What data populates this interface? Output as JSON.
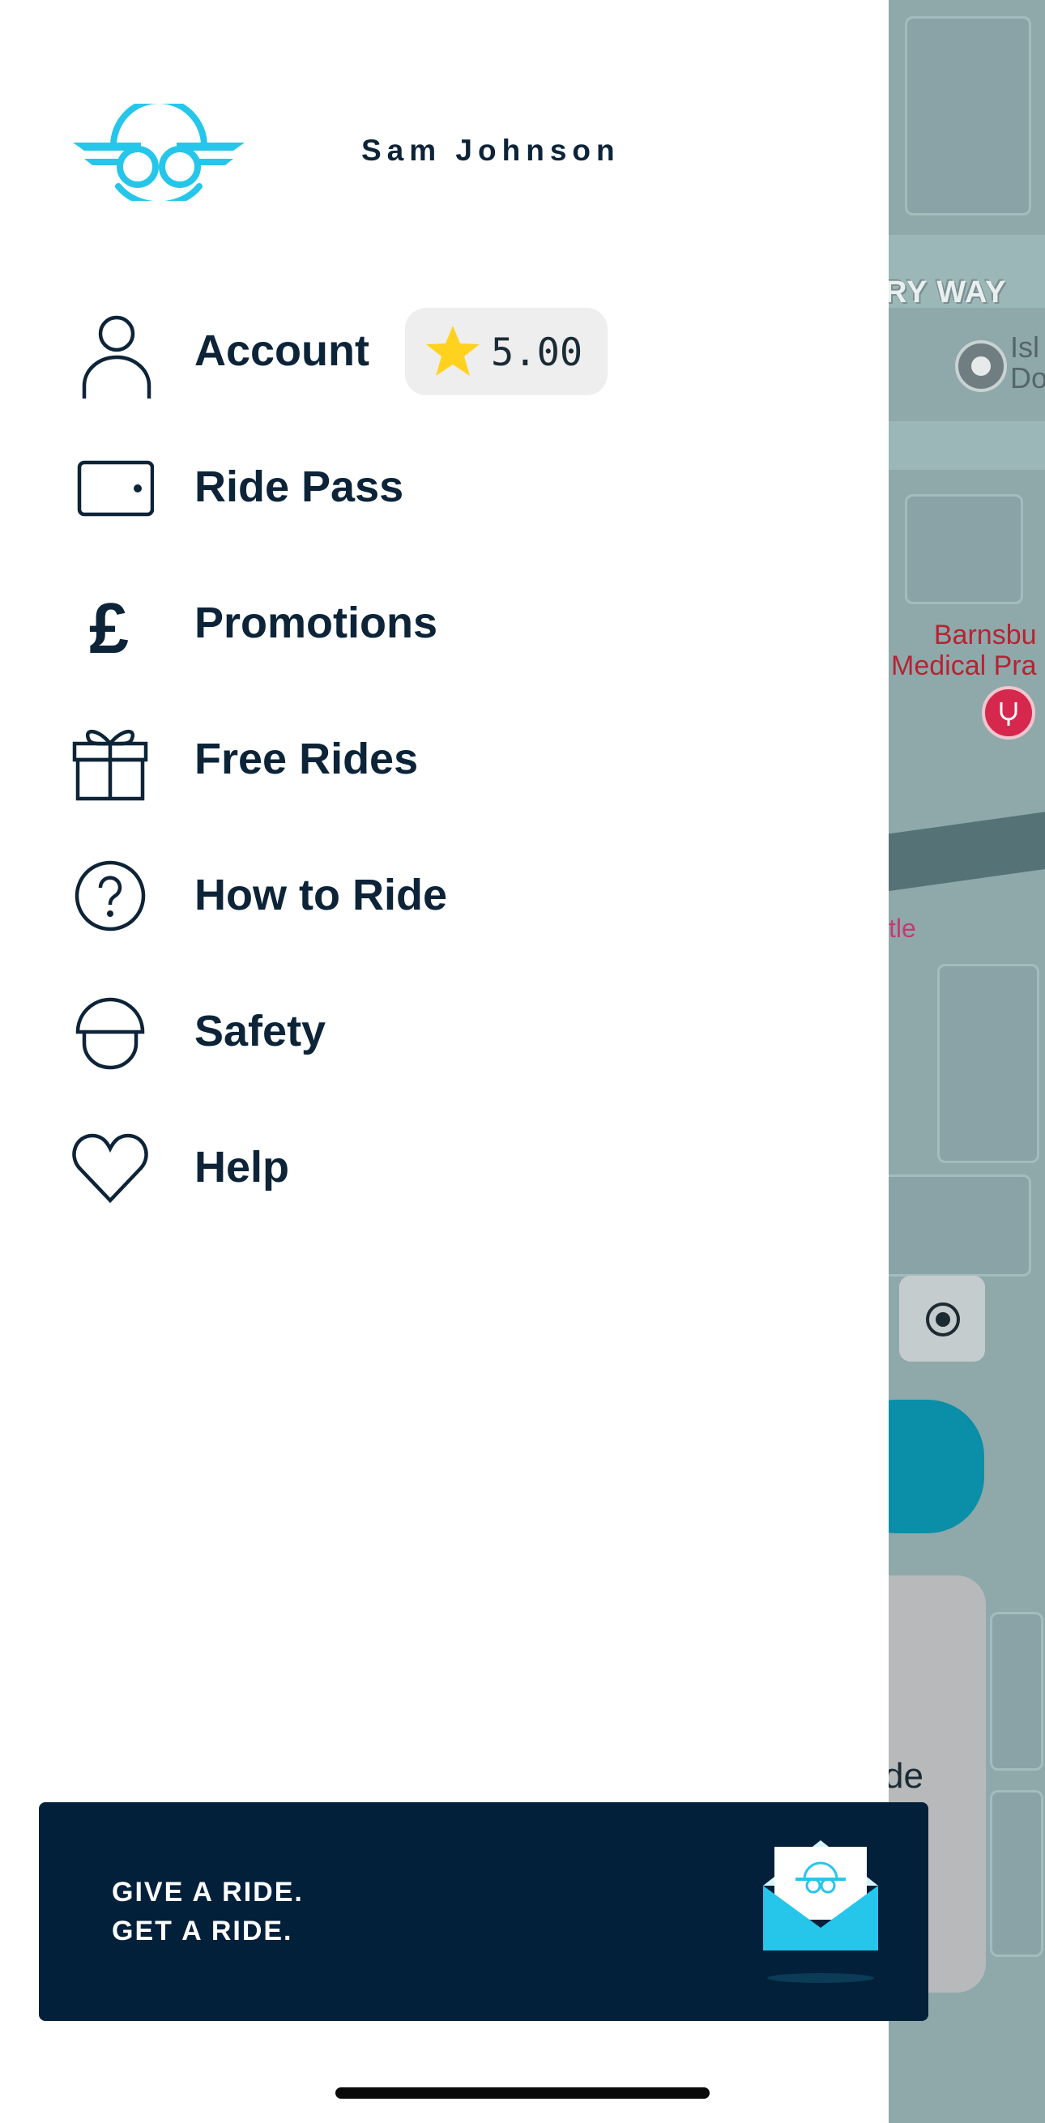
{
  "user": {
    "name": "Sam Johnson"
  },
  "rating": {
    "value": "5.00",
    "icon": "star-icon"
  },
  "menu": [
    {
      "id": "account",
      "label": "Account",
      "icon": "person-icon"
    },
    {
      "id": "ride-pass",
      "label": "Ride Pass",
      "icon": "wallet-icon"
    },
    {
      "id": "promotions",
      "label": "Promotions",
      "icon": "pound-icon"
    },
    {
      "id": "free-rides",
      "label": "Free Rides",
      "icon": "gift-icon"
    },
    {
      "id": "how-to-ride",
      "label": "How to Ride",
      "icon": "question-icon"
    },
    {
      "id": "safety",
      "label": "Safety",
      "icon": "helmet-icon"
    },
    {
      "id": "help",
      "label": "Help",
      "icon": "heart-icon"
    }
  ],
  "promo": {
    "line1": "GIVE A RIDE.",
    "line2": "GET A RIDE.",
    "icon": "envelope-icon"
  },
  "map": {
    "street": "RY WAY",
    "poi_gray_line1": "Isl",
    "poi_gray_line2": "Do",
    "poi_red_line1": "Barnsbu",
    "poi_red_line2": "Medical Pra",
    "poi_pink": "tle",
    "card_text": "de"
  },
  "colors": {
    "brand_cyan": "#26c6ea",
    "navy": "#0d2438",
    "promo_bg": "#02203a",
    "star": "#ffd21f",
    "map_teal": "#0b8ea8"
  }
}
